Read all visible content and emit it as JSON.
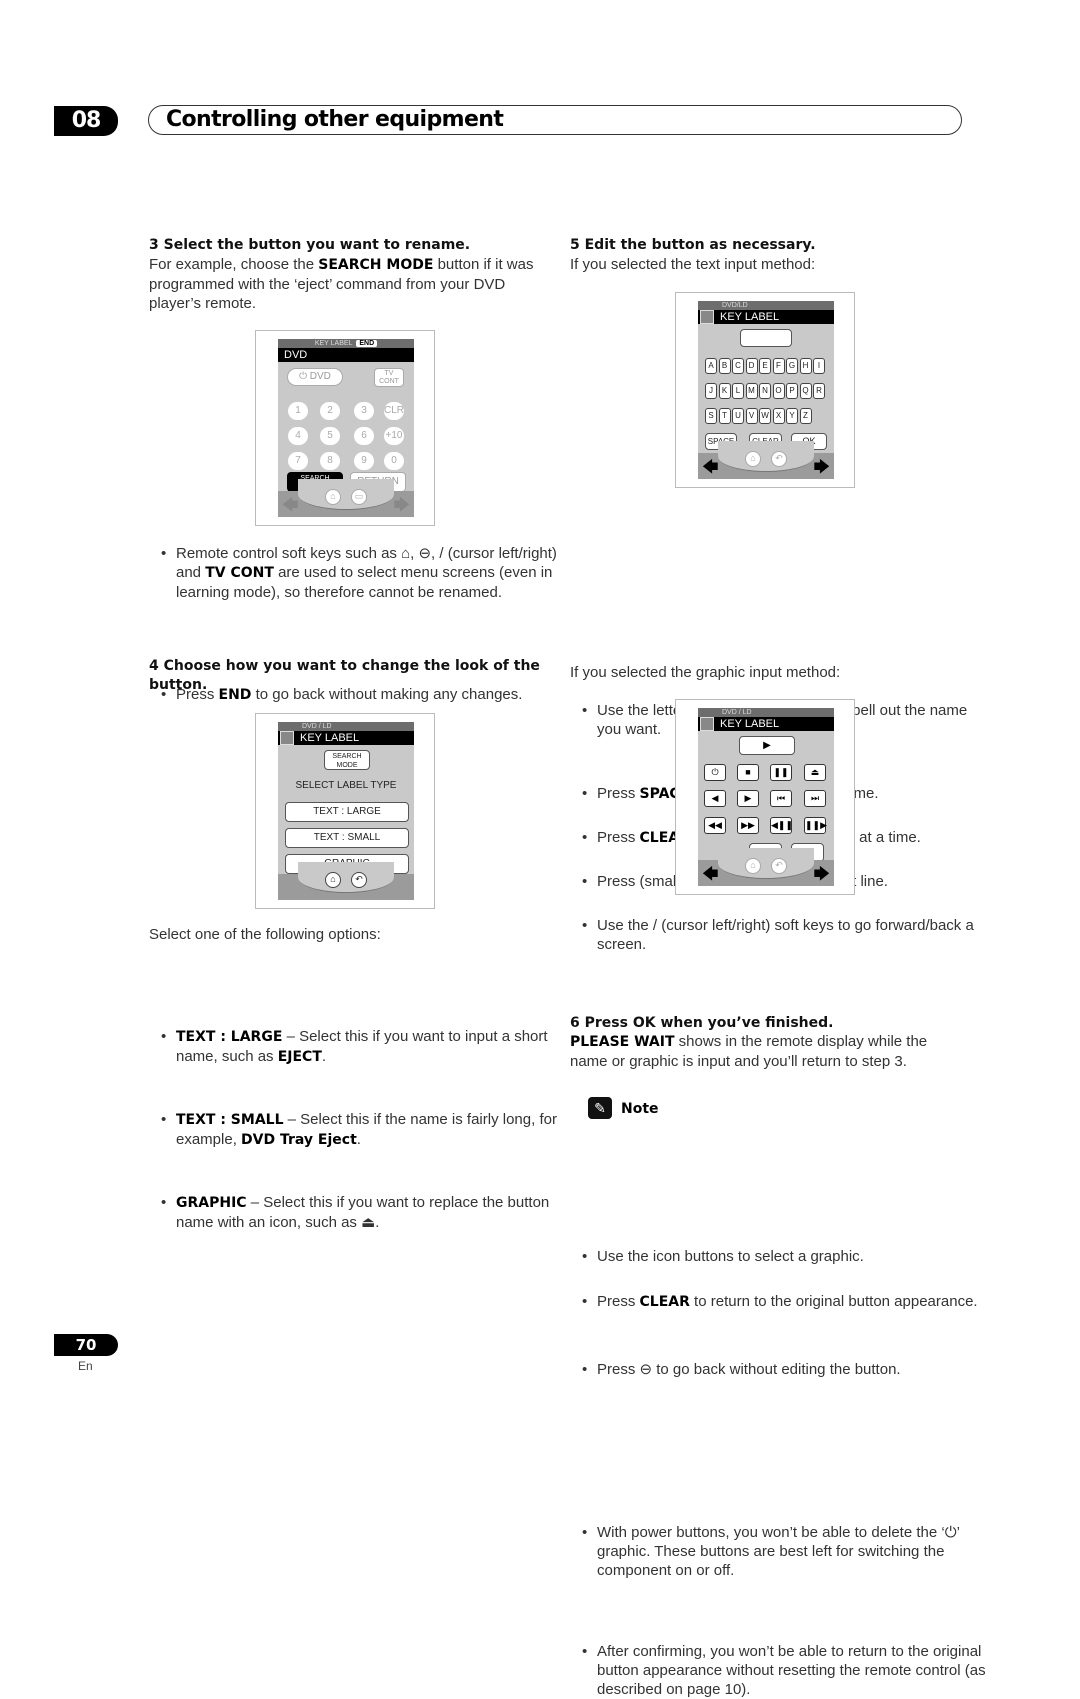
{
  "header": {
    "chapter_number": "08",
    "chapter_title": "Controlling other equipment"
  },
  "step3": {
    "heading": "3   Select the button you want to rename.",
    "body_pre": "For example, choose the ",
    "body_bold": "SEARCH MODE",
    "body_post": " button if it was programmed with the ‘eject’ command from your DVD player’s remote.",
    "bullets": [
      {
        "pre": "Remote control soft keys such as ⌂, ⊖,  / (cursor left/right) and ",
        "bold": "TV CONT",
        "post": " are used to select menu screens (even in learning mode), so therefore cannot be renamed."
      },
      {
        "pre": "Press ",
        "bold": "END",
        "post": " to go back without making any changes."
      }
    ]
  },
  "remote1": {
    "top_label": "KEY LABEL",
    "end_label": "END",
    "device": "DVD",
    "power_dvd": "⏻ DVD",
    "tv_cont_1": "TV",
    "tv_cont_2": "CONT",
    "numbers": [
      "1",
      "2",
      "3",
      "CLR",
      "4",
      "5",
      "6",
      "+10",
      "7",
      "8",
      "9",
      "0"
    ],
    "search_mode_1": "SEARCH",
    "search_mode_2": "MODE",
    "return": "RETURN",
    "left_arrow": "🡄",
    "right_arrow": "🡆",
    "home": "⌂",
    "tape": "▭"
  },
  "step4": {
    "heading": "4   Choose how you want to change the look of the button.",
    "intro": "Select one of the following options:",
    "options": [
      {
        "bold": "TEXT : LARGE",
        "pre": " – Select this if you want to input a short name, such as ",
        "bold2": "EJECT",
        "post": "."
      },
      {
        "bold": "TEXT : SMALL",
        "pre": " – Select this if the name is fairly long, for example, ",
        "bold2": "DVD Tray Eject",
        "post": "."
      },
      {
        "bold": "GRAPHIC",
        "pre": " – Select this if you want to replace the button name with an icon, such as ",
        "bold2": "",
        "post": "⏏."
      }
    ]
  },
  "remote2": {
    "top_label": "DVD / LD",
    "title": "KEY LABEL",
    "search_mode_1": "SEARCH",
    "search_mode_2": "MODE",
    "select_label_type": "SELECT LABEL TYPE",
    "options": [
      "TEXT : LARGE",
      "TEXT : SMALL",
      "GRAPHIC"
    ],
    "home": "⌂",
    "back": "↶"
  },
  "step5": {
    "heading": "5   Edit the button as necessary.",
    "text_intro": "If you selected the text input method:",
    "text_bullets": [
      {
        "pre": "Use the letter and number buttons to spell out the name you want.",
        "bold": "",
        "post": ""
      },
      {
        "pre": "Press ",
        "bold": "SPACE",
        "post": " to add a space in the name."
      },
      {
        "pre": "Press ",
        "bold": "CLEAR",
        "post": " to delete characters one at a time."
      },
      {
        "pre": "Press      (small text only) to go to the next line.",
        "bold": "",
        "post": ""
      },
      {
        "pre": "Use the  /         (cursor left/right) soft keys to go forward/back a screen.",
        "bold": "",
        "post": ""
      }
    ],
    "graphic_intro": "If you selected the graphic input method:",
    "graphic_bullets": [
      {
        "pre": "Use the icon buttons to select a graphic.",
        "bold": "",
        "post": ""
      },
      {
        "pre": "Press ",
        "bold": "CLEAR",
        "post": " to return to the original button appearance."
      },
      {
        "pre": "Press ⊖ to go back without editing the button.",
        "bold": "",
        "post": ""
      }
    ]
  },
  "remote3": {
    "top_label": "DVD/LD",
    "title": "KEY LABEL",
    "letters": [
      "A",
      "B",
      "C",
      "D",
      "E",
      "F",
      "G",
      "H",
      "I",
      "J",
      "K",
      "L",
      "M",
      "N",
      "O",
      "P",
      "Q",
      "R",
      "S",
      "T",
      "U",
      "V",
      "W",
      "X",
      "Y",
      "Z"
    ],
    "space": "SPACE",
    "clear": "CLEAR",
    "ok": "OK",
    "left_arrow": "🡄",
    "right_arrow": "🡆",
    "home": "⌂",
    "back": "↶"
  },
  "remote4": {
    "top_label": "DVD / LD",
    "title": "KEY LABEL",
    "play_top": "▶",
    "icons": [
      "⏻",
      "■",
      "❚❚",
      "⏏",
      "◀",
      "▶",
      "⏮",
      "⏭",
      "◀◀",
      "▶▶",
      "◀❚❚",
      "❚❚▶"
    ],
    "clear": "CLEAR",
    "ok": "OK",
    "left_arrow": "🡄",
    "right_arrow": "🡆",
    "home": "⌂",
    "back": "↶"
  },
  "step6": {
    "heading": "6   Press OK when you’ve finished.",
    "body_bold": "PLEASE WAIT",
    "body_post": " shows in the remote display while the name or graphic is input and you’ll return to step 3."
  },
  "note": {
    "title": "Note",
    "bullets": [
      "With power buttons, you won’t be able to delete the ‘⏻’ graphic. These buttons are best left for switching the component on or off.",
      "After confirming, you won’t be able to return to the original button appearance without resetting the remote control (as described on page 10)."
    ]
  },
  "footer": {
    "page_number": "70",
    "language": "En"
  }
}
